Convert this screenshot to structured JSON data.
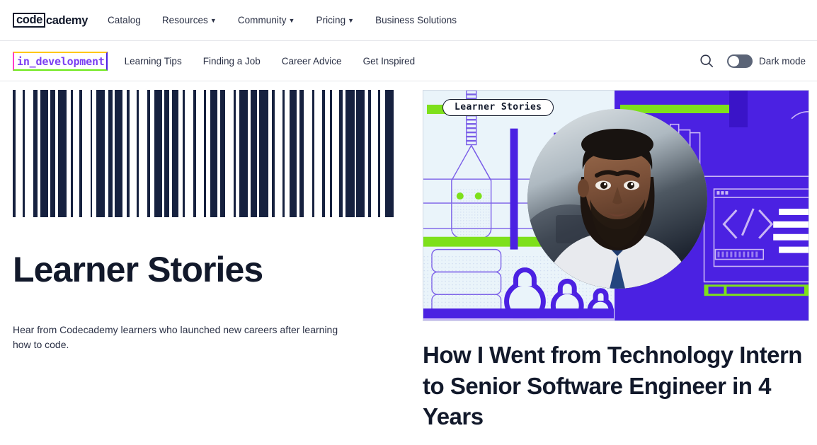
{
  "header": {
    "logo": {
      "boxed": "code",
      "tail": "cademy",
      "name": "Codecademy"
    },
    "nav": [
      {
        "label": "Catalog",
        "has_dropdown": false
      },
      {
        "label": "Resources",
        "has_dropdown": true
      },
      {
        "label": "Community",
        "has_dropdown": true
      },
      {
        "label": "Pricing",
        "has_dropdown": true
      },
      {
        "label": "Business Solutions",
        "has_dropdown": false
      }
    ]
  },
  "subnav": {
    "brand_tag": "in_development",
    "items": [
      {
        "label": "Learning Tips"
      },
      {
        "label": "Finding a Job"
      },
      {
        "label": "Career Advice"
      },
      {
        "label": "Get Inspired"
      }
    ],
    "search_icon": "search-icon",
    "dark_mode": {
      "label": "Dark mode",
      "enabled": false
    }
  },
  "hero": {
    "title": "Learner Stories",
    "subtitle": "Hear from Codecademy learners who launched new careers after learning how to code.",
    "barcode": {
      "name": "barcode-graphic",
      "widths": [
        3,
        7,
        2,
        9,
        4,
        3,
        8,
        2,
        5,
        3,
        9,
        4,
        2,
        7,
        3,
        8,
        2,
        4,
        9,
        3,
        5,
        2,
        8,
        4,
        3,
        7,
        2,
        9,
        3,
        4,
        8,
        2,
        5,
        3,
        7,
        4,
        2,
        9,
        3,
        8,
        2,
        4,
        7,
        3,
        5,
        9,
        2,
        4,
        8,
        3,
        7,
        2,
        9,
        4,
        3,
        8,
        2,
        5,
        7,
        3,
        4,
        9,
        2,
        8,
        3,
        5,
        2,
        7,
        4,
        3,
        9,
        2,
        8,
        4,
        3,
        7,
        2,
        5,
        9,
        3
      ]
    }
  },
  "featured": {
    "card": {
      "badge": "Learner Stories",
      "name": "learner-stories-illustration",
      "colors": {
        "purple": "#4B21E2",
        "green": "#7EE01B",
        "light": "#EAF4FA"
      }
    },
    "article_title": "How I Went from Technology Intern to Senior Software Engineer in 4 Years"
  },
  "colors": {
    "navy": "#12192B",
    "purple": "#4B21E2",
    "green": "#7EE01B",
    "magenta": "#FF3DC8",
    "yellow": "#FFC700",
    "tag_text": "#7B3FF2"
  }
}
